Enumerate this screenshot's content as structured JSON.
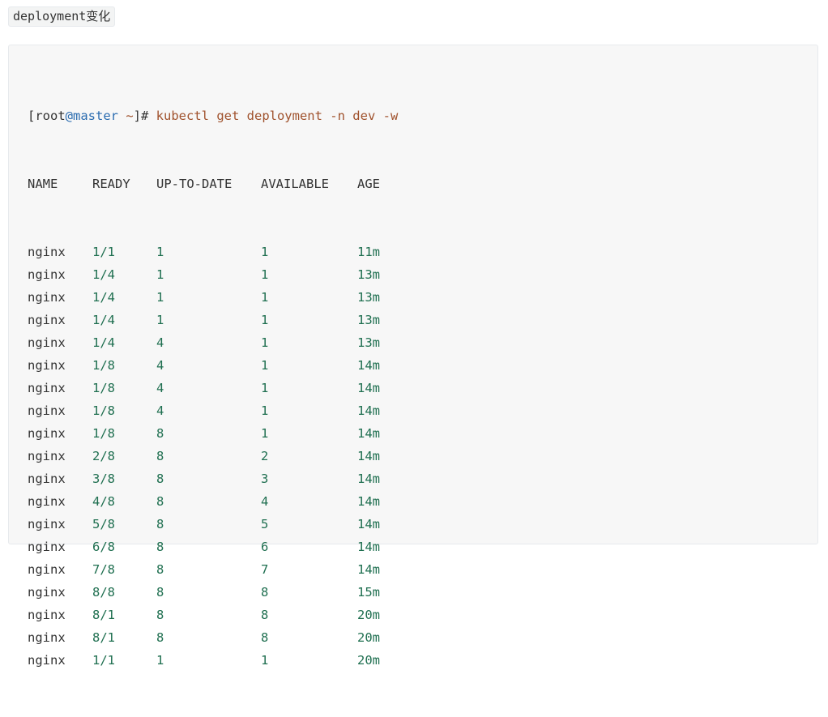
{
  "heading_code": "deployment变化",
  "prompt": {
    "open_bracket": "[",
    "user": "root",
    "at_host": "@master",
    "path": " ~",
    "close": "]# ",
    "command": "kubectl get deployment -n dev -w"
  },
  "table": {
    "headers": [
      "NAME",
      "READY",
      "UP-TO-DATE",
      "AVAILABLE",
      "AGE"
    ],
    "rows": [
      [
        "nginx",
        "1/1",
        "1",
        "1",
        "11m"
      ],
      [
        "nginx",
        "1/4",
        "1",
        "1",
        "13m"
      ],
      [
        "nginx",
        "1/4",
        "1",
        "1",
        "13m"
      ],
      [
        "nginx",
        "1/4",
        "1",
        "1",
        "13m"
      ],
      [
        "nginx",
        "1/4",
        "4",
        "1",
        "13m"
      ],
      [
        "nginx",
        "1/8",
        "4",
        "1",
        "14m"
      ],
      [
        "nginx",
        "1/8",
        "4",
        "1",
        "14m"
      ],
      [
        "nginx",
        "1/8",
        "4",
        "1",
        "14m"
      ],
      [
        "nginx",
        "1/8",
        "8",
        "1",
        "14m"
      ],
      [
        "nginx",
        "2/8",
        "8",
        "2",
        "14m"
      ],
      [
        "nginx",
        "3/8",
        "8",
        "3",
        "14m"
      ],
      [
        "nginx",
        "4/8",
        "8",
        "4",
        "14m"
      ],
      [
        "nginx",
        "5/8",
        "8",
        "5",
        "14m"
      ],
      [
        "nginx",
        "6/8",
        "8",
        "6",
        "14m"
      ],
      [
        "nginx",
        "7/8",
        "8",
        "7",
        "14m"
      ],
      [
        "nginx",
        "8/8",
        "8",
        "8",
        "15m"
      ],
      [
        "nginx",
        "8/1",
        "8",
        "8",
        "20m"
      ],
      [
        "nginx",
        "8/1",
        "8",
        "8",
        "20m"
      ],
      [
        "nginx",
        "1/1",
        "1",
        "1",
        "20m"
      ]
    ]
  },
  "colors": {
    "text": "#333333",
    "hostname": "#2b6cb0",
    "command": "#a0522d",
    "number": "#1f6f50",
    "block_background": "#f7f7f7"
  }
}
